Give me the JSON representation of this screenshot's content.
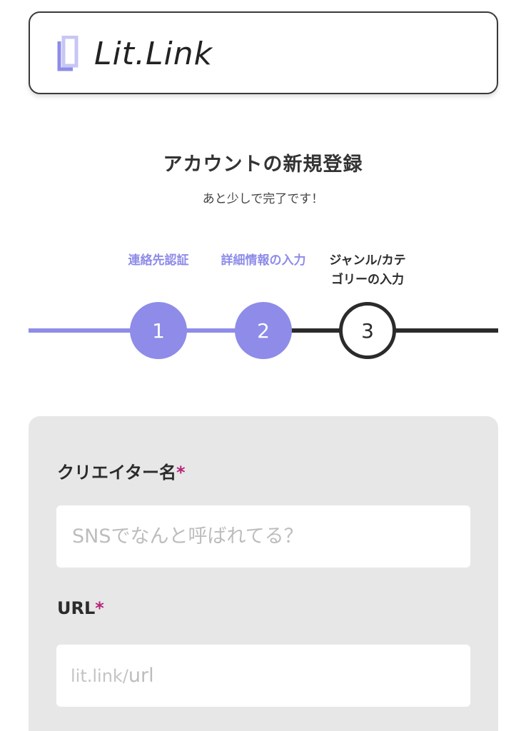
{
  "header": {
    "logo_text": "Lit.Link"
  },
  "page": {
    "title": "アカウントの新規登録",
    "subtitle": "あと少しで完了です！"
  },
  "steps": [
    {
      "label": "連絡先認証",
      "number": "1",
      "state": "done"
    },
    {
      "label": "詳細情報の入力",
      "number": "2",
      "state": "done"
    },
    {
      "label_line1": "ジャンル/カテ",
      "label_line2": "ゴリーの入力",
      "number": "3",
      "state": "current"
    }
  ],
  "form": {
    "creator_name": {
      "label": "クリエイター名",
      "required_mark": "*",
      "placeholder": "SNSでなんと呼ばれてる？",
      "value": ""
    },
    "url": {
      "label": "URL",
      "required_mark": "*",
      "prefix": "lit.link/",
      "placeholder": "url",
      "value": ""
    }
  },
  "colors": {
    "accent": "#8e8ce8",
    "dark": "#2b2b2b",
    "required": "#b8237a",
    "panel": "#e7e7e7"
  }
}
